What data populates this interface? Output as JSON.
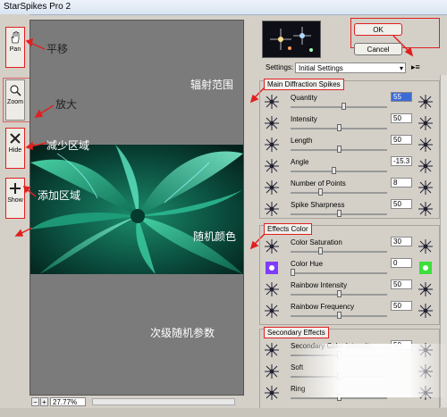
{
  "window": {
    "title": "StarSpikes Pro 2"
  },
  "tools": [
    {
      "label": "Pan",
      "icon": "hand-icon",
      "note": "平移"
    },
    {
      "label": "Zoom",
      "icon": "magnifier-icon",
      "note": "放大"
    },
    {
      "label": "Hide",
      "icon": "x-icon",
      "note": "减少区域"
    },
    {
      "label": "Show",
      "icon": "plus-icon",
      "note": "添加区域"
    }
  ],
  "annotations": {
    "radiation_range": "辐射范围",
    "random_color": "随机颜色",
    "secondary_random": "次级随机参数"
  },
  "zoom": {
    "value": "27.77%",
    "minus": "−",
    "plus": "+"
  },
  "buttons": {
    "ok": "OK",
    "cancel": "Cancel"
  },
  "settings": {
    "label": "Settings:",
    "value": "Initial Settings"
  },
  "groups": {
    "main": {
      "title": "Main Diffraction Spikes",
      "rows": [
        {
          "label": "Quantity",
          "value": "55",
          "slider": 0.55,
          "selected": true
        },
        {
          "label": "Intensity",
          "value": "50",
          "slider": 0.5
        },
        {
          "label": "Length",
          "value": "50",
          "slider": 0.5
        },
        {
          "label": "Angle",
          "value": "-15.3",
          "slider": 0.45
        },
        {
          "label": "Number of Points",
          "value": "8",
          "slider": 0.3
        },
        {
          "label": "Spike Sharpness",
          "value": "50",
          "slider": 0.5
        }
      ]
    },
    "effects": {
      "title": "Effects Color",
      "rows": [
        {
          "label": "Color Saturation",
          "value": "30",
          "slider": 0.3
        },
        {
          "label": "Color Hue",
          "value": "0",
          "slider": 0.0
        },
        {
          "label": "Rainbow Intensity",
          "value": "50",
          "slider": 0.5
        },
        {
          "label": "Rainbow Frequency",
          "value": "50",
          "slider": 0.5
        }
      ]
    },
    "secondary": {
      "title": "Secondary Effects",
      "rows": [
        {
          "label": "Secondary Color Intensity",
          "value": "50",
          "slider": 0.5
        },
        {
          "label": "Soft",
          "value": "",
          "slider": 0.5
        },
        {
          "label": "Ring",
          "value": "",
          "slider": 0.5
        }
      ]
    }
  },
  "colors": {
    "accent_red": "#e02020",
    "canvas_gray": "#7b7b7b",
    "selected_field": "#3d6bd4"
  }
}
